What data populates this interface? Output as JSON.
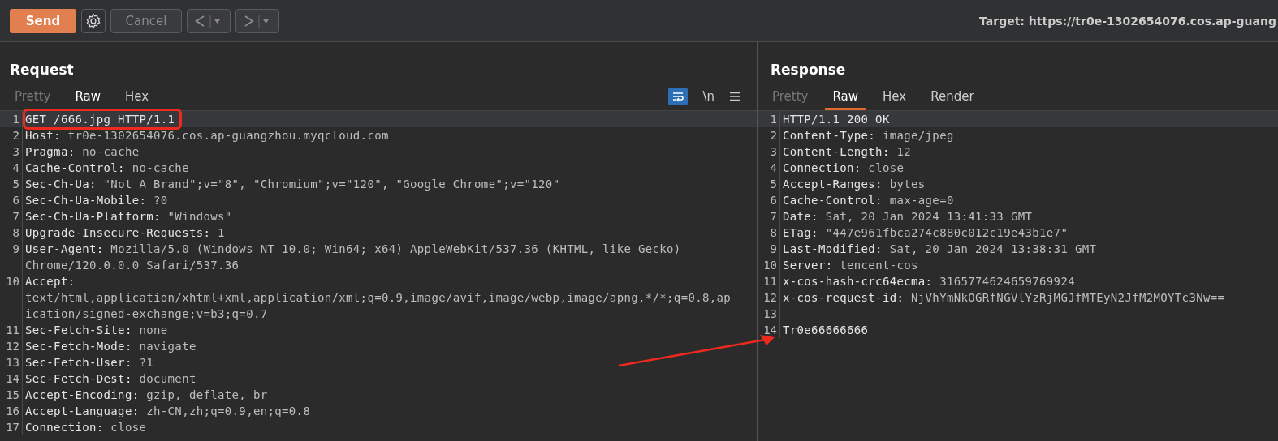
{
  "toolbar": {
    "send": "Send",
    "cancel": {
      "label": "Cancel",
      "disabled": true
    },
    "target": "Target: https://tr0e-1302654076.cos.ap-guang"
  },
  "request": {
    "title": "Request",
    "active": false,
    "tabs": [
      {
        "label": "Pretty",
        "selected": false,
        "disabled": true
      },
      {
        "label": "Raw",
        "selected": true,
        "disabled": false
      },
      {
        "label": "Hex",
        "selected": false,
        "disabled": false
      }
    ],
    "wrap_on": true,
    "newline_toggle": "\\n",
    "lines": [
      {
        "num": "1",
        "rows": [
          "GET /666.jpg HTTP/1.1"
        ],
        "highlighted": true,
        "current": true
      },
      {
        "num": "2",
        "key": "Host:",
        "rows": [
          " tr0e-1302654076.cos.ap-guangzhou.myqcloud.com"
        ]
      },
      {
        "num": "3",
        "key": "Pragma:",
        "rows": [
          " no-cache"
        ]
      },
      {
        "num": "4",
        "key": "Cache-Control:",
        "rows": [
          " no-cache"
        ]
      },
      {
        "num": "5",
        "key": "Sec-Ch-Ua:",
        "rows": [
          " \"Not_A Brand\";v=\"8\", \"Chromium\";v=\"120\", \"Google Chrome\";v=\"120\""
        ]
      },
      {
        "num": "6",
        "key": "Sec-Ch-Ua-Mobile:",
        "rows": [
          " ?0"
        ]
      },
      {
        "num": "7",
        "key": "Sec-Ch-Ua-Platform:",
        "rows": [
          " \"Windows\""
        ]
      },
      {
        "num": "8",
        "key": "Upgrade-Insecure-Requests:",
        "rows": [
          " 1"
        ]
      },
      {
        "num": "9",
        "key": "User-Agent:",
        "rows": [
          " Mozilla/5.0 (Windows NT 10.0; Win64; x64) AppleWebKit/537.36 (KHTML, like Gecko)",
          "Chrome/120.0.0.0 Safari/537.36"
        ]
      },
      {
        "num": "10",
        "key": "Accept:",
        "break_after_key": true,
        "rows": [
          "text/html,application/xhtml+xml,application/xml;q=0.9,image/avif,image/webp,image/apng,*/*;q=0.8,ap",
          "ication/signed-exchange;v=b3;q=0.7"
        ]
      },
      {
        "num": "11",
        "key": "Sec-Fetch-Site:",
        "rows": [
          " none"
        ]
      },
      {
        "num": "12",
        "key": "Sec-Fetch-Mode:",
        "rows": [
          " navigate"
        ]
      },
      {
        "num": "13",
        "key": "Sec-Fetch-User:",
        "rows": [
          " ?1"
        ]
      },
      {
        "num": "14",
        "key": "Sec-Fetch-Dest:",
        "rows": [
          " document"
        ]
      },
      {
        "num": "15",
        "key": "Accept-Encoding:",
        "rows": [
          " gzip, deflate, br"
        ]
      },
      {
        "num": "16",
        "key": "Accept-Language:",
        "rows": [
          " zh-CN,zh;q=0.9,en;q=0.8"
        ]
      },
      {
        "num": "17",
        "key": "Connection:",
        "rows": [
          " close"
        ]
      }
    ]
  },
  "response": {
    "title": "Response",
    "active": true,
    "tabs": [
      {
        "label": "Pretty",
        "selected": false,
        "disabled": true
      },
      {
        "label": "Raw",
        "selected": true,
        "disabled": false
      },
      {
        "label": "Hex",
        "selected": false,
        "disabled": false
      },
      {
        "label": "Render",
        "selected": false,
        "disabled": false
      }
    ],
    "lines": [
      {
        "num": "1",
        "rows": [
          "HTTP/1.1 200 OK"
        ],
        "current": true
      },
      {
        "num": "2",
        "key": "Content-Type:",
        "rows": [
          " image/jpeg"
        ]
      },
      {
        "num": "3",
        "key": "Content-Length:",
        "rows": [
          " 12"
        ]
      },
      {
        "num": "4",
        "key": "Connection:",
        "rows": [
          " close"
        ]
      },
      {
        "num": "5",
        "key": "Accept-Ranges:",
        "rows": [
          " bytes"
        ]
      },
      {
        "num": "6",
        "key": "Cache-Control:",
        "rows": [
          " max-age=0"
        ]
      },
      {
        "num": "7",
        "key": "Date:",
        "rows": [
          " Sat, 20 Jan 2024 13:41:33 GMT"
        ]
      },
      {
        "num": "8",
        "key": "ETag:",
        "rows": [
          " \"447e961fbca274c880c012c19e43b1e7\""
        ]
      },
      {
        "num": "9",
        "key": "Last-Modified:",
        "rows": [
          " Sat, 20 Jan 2024 13:38:31 GMT"
        ]
      },
      {
        "num": "10",
        "key": "Server:",
        "rows": [
          " tencent-cos"
        ]
      },
      {
        "num": "11",
        "key": "x-cos-hash-crc64ecma:",
        "rows": [
          " 3165774624659769924"
        ]
      },
      {
        "num": "12",
        "key": "x-cos-request-id:",
        "rows": [
          " NjVhYmNkOGRfNGVlYzRjMGJfMTEyN2JfM2MOYTc3Nw=="
        ]
      },
      {
        "num": "13"
      },
      {
        "num": "14",
        "rows": [
          "Tr0e66666666"
        ]
      }
    ]
  }
}
